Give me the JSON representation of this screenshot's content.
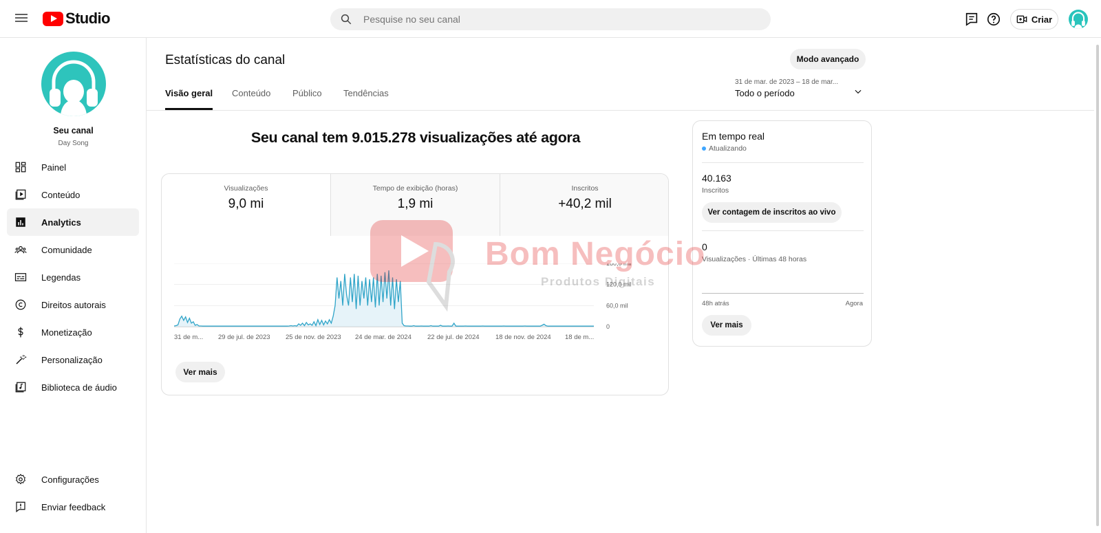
{
  "header": {
    "app_name": "Studio",
    "search_placeholder": "Pesquise no seu canal",
    "create_label": "Criar"
  },
  "sidebar": {
    "channel_name": "Seu canal",
    "channel_handle": "Day Song",
    "items": [
      {
        "label": "Painel",
        "icon": "dashboard-icon"
      },
      {
        "label": "Conteúdo",
        "icon": "content-icon"
      },
      {
        "label": "Analytics",
        "icon": "analytics-icon",
        "active": true
      },
      {
        "label": "Comunidade",
        "icon": "community-icon"
      },
      {
        "label": "Legendas",
        "icon": "subtitles-icon"
      },
      {
        "label": "Direitos autorais",
        "icon": "copyright-icon"
      },
      {
        "label": "Monetização",
        "icon": "dollar-icon"
      },
      {
        "label": "Personalização",
        "icon": "magic-wand-icon"
      },
      {
        "label": "Biblioteca de áudio",
        "icon": "audio-library-icon"
      }
    ],
    "bottom_items": [
      {
        "label": "Configurações",
        "icon": "gear-icon"
      },
      {
        "label": "Enviar feedback",
        "icon": "feedback-icon"
      }
    ]
  },
  "main": {
    "title": "Estatísticas do canal",
    "advanced_button": "Modo avançado",
    "tabs": [
      "Visão geral",
      "Conteúdo",
      "Público",
      "Tendências"
    ],
    "period_range": "31 de mar. de 2023 – 18 de mar...",
    "period_label": "Todo o período",
    "headline": "Seu canal tem 9.015.278 visualizações até agora",
    "metrics": [
      {
        "label": "Visualizações",
        "value": "9,0 mi"
      },
      {
        "label": "Tempo de exibição (horas)",
        "value": "1,9 mi"
      },
      {
        "label": "Inscritos",
        "value": "+40,2 mil"
      }
    ],
    "see_more": "Ver mais"
  },
  "realtime": {
    "title": "Em tempo real",
    "status": "Atualizando",
    "subscribers_value": "40.163",
    "subscribers_label": "Inscritos",
    "live_count_button": "Ver contagem de inscritos ao vivo",
    "views_value": "0",
    "views_label": "Visualizações · Últimas 48 horas",
    "axis_start": "48h atrás",
    "axis_end": "Agora",
    "see_more": "Ver mais"
  },
  "watermark": {
    "brand": "Bom Negócio",
    "tagline": "Produtos Digitais"
  },
  "colors": {
    "accent_line": "#2fa4c8",
    "accent_fill": "#dbeef6",
    "brand_red": "#ff0000",
    "avatar_teal": "#2ec4bc",
    "live_dot": "#3ea6ff"
  },
  "chart_data": {
    "type": "line",
    "title": "",
    "xlabel": "",
    "ylabel": "",
    "x_tick_labels": [
      "31 de m...",
      "29 de jul. de 2023",
      "25 de nov. de 2023",
      "24 de mar. de 2024",
      "22 de jul. de 2024",
      "18 de nov. de 2024",
      "18 de m..."
    ],
    "y_tick_labels": [
      "0",
      "60,0 mil",
      "120,0 mil",
      "180,0 mil"
    ],
    "ylim": [
      0,
      180000
    ],
    "series": [
      {
        "values": [
          2000,
          3000,
          5000,
          22000,
          30000,
          18000,
          28000,
          12000,
          24000,
          10000,
          14000,
          4000,
          6000,
          2000,
          2000,
          1500,
          1500,
          1500,
          1500,
          1500,
          1500,
          1500,
          1500,
          1500,
          1500,
          1500,
          1500,
          1500,
          1500,
          1500,
          1500,
          1500,
          1500,
          1500,
          1500,
          1500,
          1500,
          1500,
          1500,
          1500,
          1500,
          1500,
          1500,
          1500,
          1500,
          1500,
          1500,
          1500,
          1500,
          1500,
          1500,
          1500,
          1500,
          1500,
          1500,
          1500,
          1500,
          1500,
          1500,
          1500,
          2000,
          3000,
          2000,
          3000,
          2000,
          8000,
          4000,
          10000,
          3000,
          12000,
          5000,
          8000,
          4000,
          14000,
          3000,
          20000,
          6000,
          18000,
          5000,
          16000,
          8000,
          20000,
          10000,
          30000,
          60000,
          140000,
          80000,
          130000,
          60000,
          150000,
          90000,
          60000,
          140000,
          70000,
          150000,
          50000,
          145000,
          60000,
          130000,
          80000,
          140000,
          60000,
          135000,
          70000,
          140000,
          55000,
          150000,
          60000,
          145000,
          70000,
          155000,
          80000,
          160000,
          60000,
          140000,
          50000,
          135000,
          70000,
          130000,
          10000,
          3000,
          2000,
          2000,
          1500,
          1500,
          3000,
          1500,
          1500,
          1500,
          2000,
          1500,
          1500,
          1500,
          1500,
          3000,
          1500,
          1500,
          1500,
          1500,
          4000,
          1500,
          1500,
          1500,
          2000,
          1500,
          1500,
          10000,
          1500,
          1500,
          1500,
          1500,
          1500,
          2000,
          1500,
          1500,
          1500,
          1500,
          1500,
          1500,
          1500,
          1500,
          2000,
          1500,
          1500,
          1500,
          1500,
          1500,
          1500,
          1500,
          1500,
          1500,
          1500,
          2000,
          1500,
          1500,
          1500,
          1500,
          1500,
          1500,
          1500,
          1500,
          1500,
          1500,
          2000,
          1500,
          1500,
          1500,
          1500,
          1500,
          1500,
          1500,
          1500,
          4000,
          7000,
          3000,
          1500,
          1500,
          1500,
          1500,
          1500,
          1500,
          1500,
          1500,
          1500,
          1500,
          1500,
          1500,
          1500,
          1500,
          1500,
          1500,
          1500,
          1500,
          1500,
          1500,
          1500,
          1500,
          1500,
          1500,
          1500
        ]
      }
    ]
  }
}
